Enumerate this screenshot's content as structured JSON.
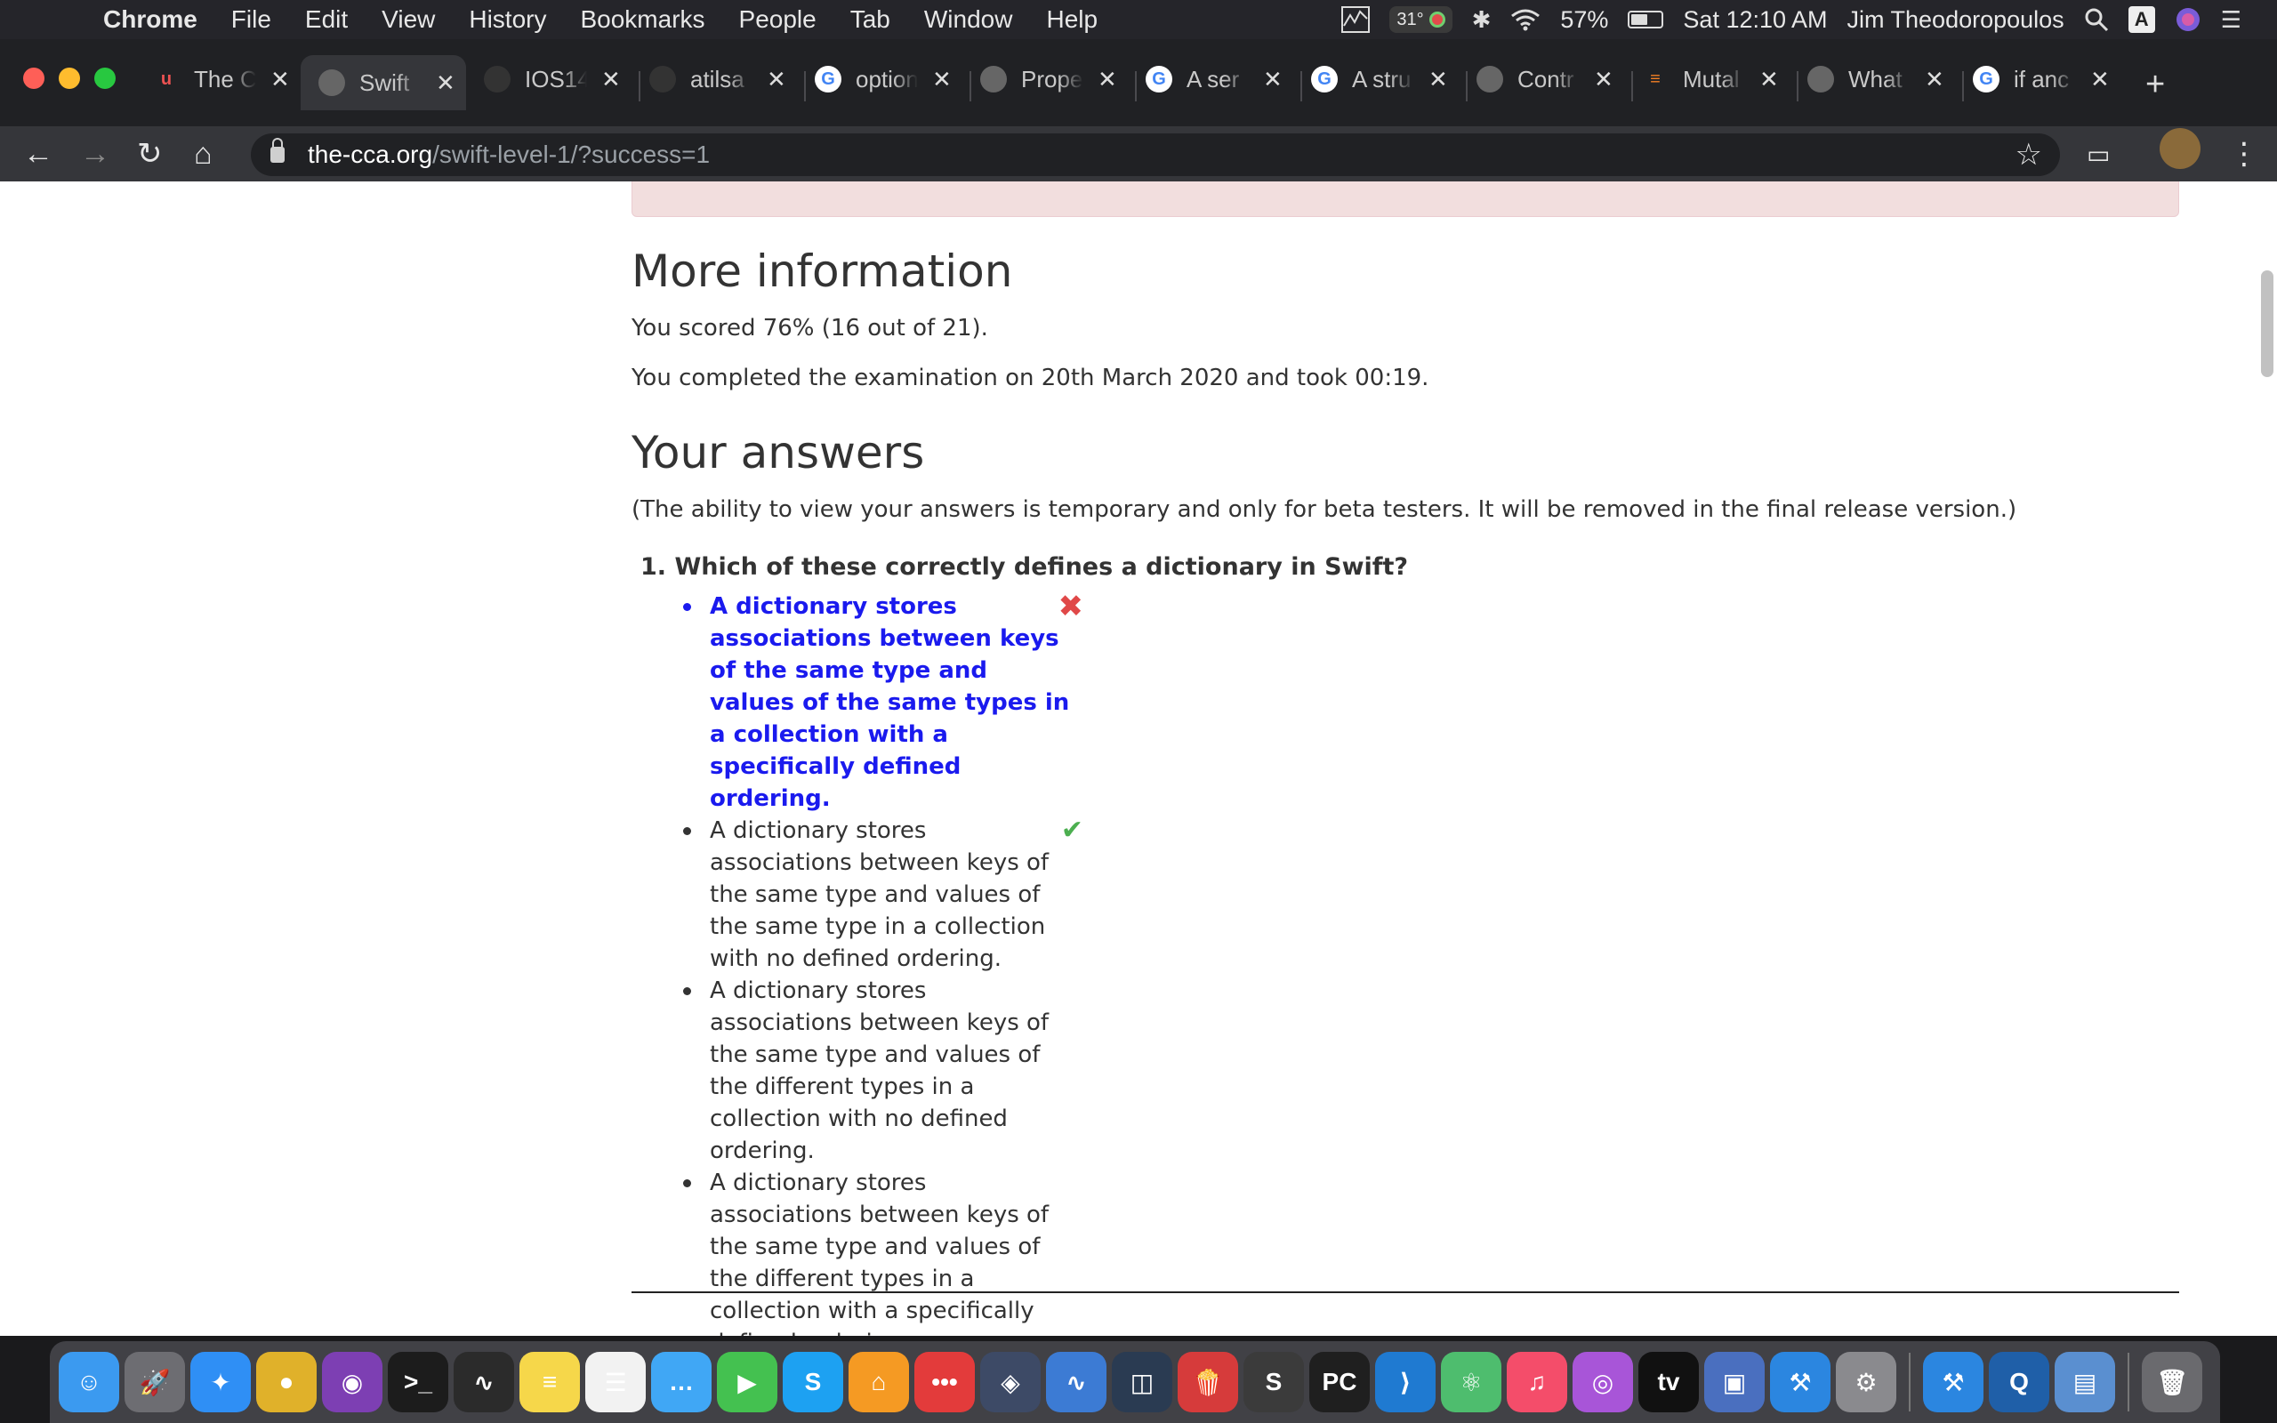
{
  "menubar": {
    "app_name": "Chrome",
    "menus": [
      "File",
      "Edit",
      "View",
      "History",
      "Bookmarks",
      "People",
      "Tab",
      "Window",
      "Help"
    ],
    "temperature": "31°",
    "battery_percent": "57%",
    "battery_level": 0.57,
    "clock": "Sat 12:10 AM",
    "user": "Jim Theodoropoulos",
    "input_source": "A"
  },
  "tabs": [
    {
      "title": "The C",
      "favicon": "udemy-icon",
      "color": "#ec5252"
    },
    {
      "title": "Swift",
      "favicon": "globe-icon",
      "color": "#666666",
      "active": true
    },
    {
      "title": "IOS14",
      "favicon": "github-icon",
      "color": "#333333"
    },
    {
      "title": "atilsa",
      "favicon": "github-icon",
      "color": "#333333"
    },
    {
      "title": "option",
      "favicon": "google-icon",
      "color": "#ffffff"
    },
    {
      "title": "Prope",
      "favicon": "globe-icon",
      "color": "#666666"
    },
    {
      "title": "A ser",
      "favicon": "google-icon",
      "color": "#ffffff"
    },
    {
      "title": "A stru",
      "favicon": "google-icon",
      "color": "#ffffff"
    },
    {
      "title": "Contr",
      "favicon": "globe-icon",
      "color": "#666666"
    },
    {
      "title": "Mutal",
      "favicon": "stackoverflow-icon",
      "color": "#f48024"
    },
    {
      "title": "What",
      "favicon": "globe-icon",
      "color": "#666666"
    },
    {
      "title": "if anc",
      "favicon": "google-icon",
      "color": "#ffffff"
    }
  ],
  "address": {
    "domain": "the-cca.org",
    "path": "/swift-level-1/?success=1"
  },
  "page": {
    "more_info_heading": "More information",
    "score_line": "You scored 76% (16 out of 21).",
    "completed_line": "You completed the examination on 20th March 2020 and took 00:19.",
    "answers_heading": "Your answers",
    "beta_note": "(The ability to view your answers is temporary and only for beta testers. It will be removed in the final release version.)",
    "question": "1. Which of these correctly defines a dictionary in Swift?",
    "answers": [
      {
        "text": "A dictionary stores associations between keys of the same type and values of the same types in a collection with a specifically defined ordering.",
        "chosen": true,
        "mark": "wrong"
      },
      {
        "text": "A dictionary stores associations between keys of the same type and values of the same type in a collection with no defined ordering.",
        "chosen": false,
        "mark": "right"
      },
      {
        "text": "A dictionary stores associations between keys of the same type and values of the different types in a collection with no defined ordering.",
        "chosen": false,
        "mark": ""
      },
      {
        "text": "A dictionary stores associations between keys of the same type and values of the different types in a collection with a specifically defined ordering.",
        "chosen": false,
        "mark": ""
      }
    ]
  },
  "dock": [
    {
      "name": "finder-icon",
      "glyph": "☺",
      "color": "#3b9af0"
    },
    {
      "name": "launchpad-icon",
      "glyph": "🚀",
      "color": "#6d6d72"
    },
    {
      "name": "safari-icon",
      "glyph": "✦",
      "color": "#2f8ff5"
    },
    {
      "name": "chrome-icon",
      "glyph": "●",
      "color": "#e0b12a"
    },
    {
      "name": "tor-icon",
      "glyph": "◉",
      "color": "#7d3fb3"
    },
    {
      "name": "terminal-icon",
      "glyph": ">_",
      "color": "#1c1c1c"
    },
    {
      "name": "activity-monitor-icon",
      "glyph": "∿",
      "color": "#2b2b2b"
    },
    {
      "name": "notes-icon",
      "glyph": "≡",
      "color": "#f6d74a"
    },
    {
      "name": "reminders-icon",
      "glyph": "☰",
      "color": "#f2f2f2"
    },
    {
      "name": "messages-icon",
      "glyph": "…",
      "color": "#40a7f5"
    },
    {
      "name": "facetime-icon",
      "glyph": "▶",
      "color": "#44c150"
    },
    {
      "name": "skype-icon",
      "glyph": "S",
      "color": "#1da1f2"
    },
    {
      "name": "home-icon",
      "glyph": "⌂",
      "color": "#f59a23"
    },
    {
      "name": "more-apps-icon",
      "glyph": "•••",
      "color": "#e33b3b"
    },
    {
      "name": "davinci-icon",
      "glyph": "◈",
      "color": "#3d4a66"
    },
    {
      "name": "istat-icon",
      "glyph": "∿",
      "color": "#3c7bd4"
    },
    {
      "name": "dash-icon",
      "glyph": "◫",
      "color": "#2a3b52"
    },
    {
      "name": "popcorn-icon",
      "glyph": "🍿",
      "color": "#d63b3b"
    },
    {
      "name": "sublime-icon",
      "glyph": "S",
      "color": "#3b3b3b"
    },
    {
      "name": "pycharm-icon",
      "glyph": "PC",
      "color": "#1f1f1f"
    },
    {
      "name": "vscode-icon",
      "glyph": "⟩",
      "color": "#1f7ad1"
    },
    {
      "name": "atom-icon",
      "glyph": "⚛",
      "color": "#4ebd6e"
    },
    {
      "name": "music-icon",
      "glyph": "♫",
      "color": "#f44d6a"
    },
    {
      "name": "podcasts-icon",
      "glyph": "◎",
      "color": "#a855d8"
    },
    {
      "name": "tv-icon",
      "glyph": "tv",
      "color": "#111111"
    },
    {
      "name": "virtualbox-icon",
      "glyph": "▣",
      "color": "#4a6fbf"
    },
    {
      "name": "xcode-icon",
      "glyph": "⚒",
      "color": "#2b86e0"
    },
    {
      "name": "system-preferences-icon",
      "glyph": "⚙",
      "color": "#8a8a8e"
    },
    {
      "name": "xcode-beta-icon",
      "glyph": "⚒",
      "color": "#2b86e0"
    },
    {
      "name": "quicktime-icon",
      "glyph": "Q",
      "color": "#1f5fa8"
    },
    {
      "name": "preview-icon",
      "glyph": "▤",
      "color": "#5a8fd0"
    },
    {
      "name": "trash-icon",
      "glyph": "🗑",
      "color": "#6a6a6e"
    }
  ]
}
